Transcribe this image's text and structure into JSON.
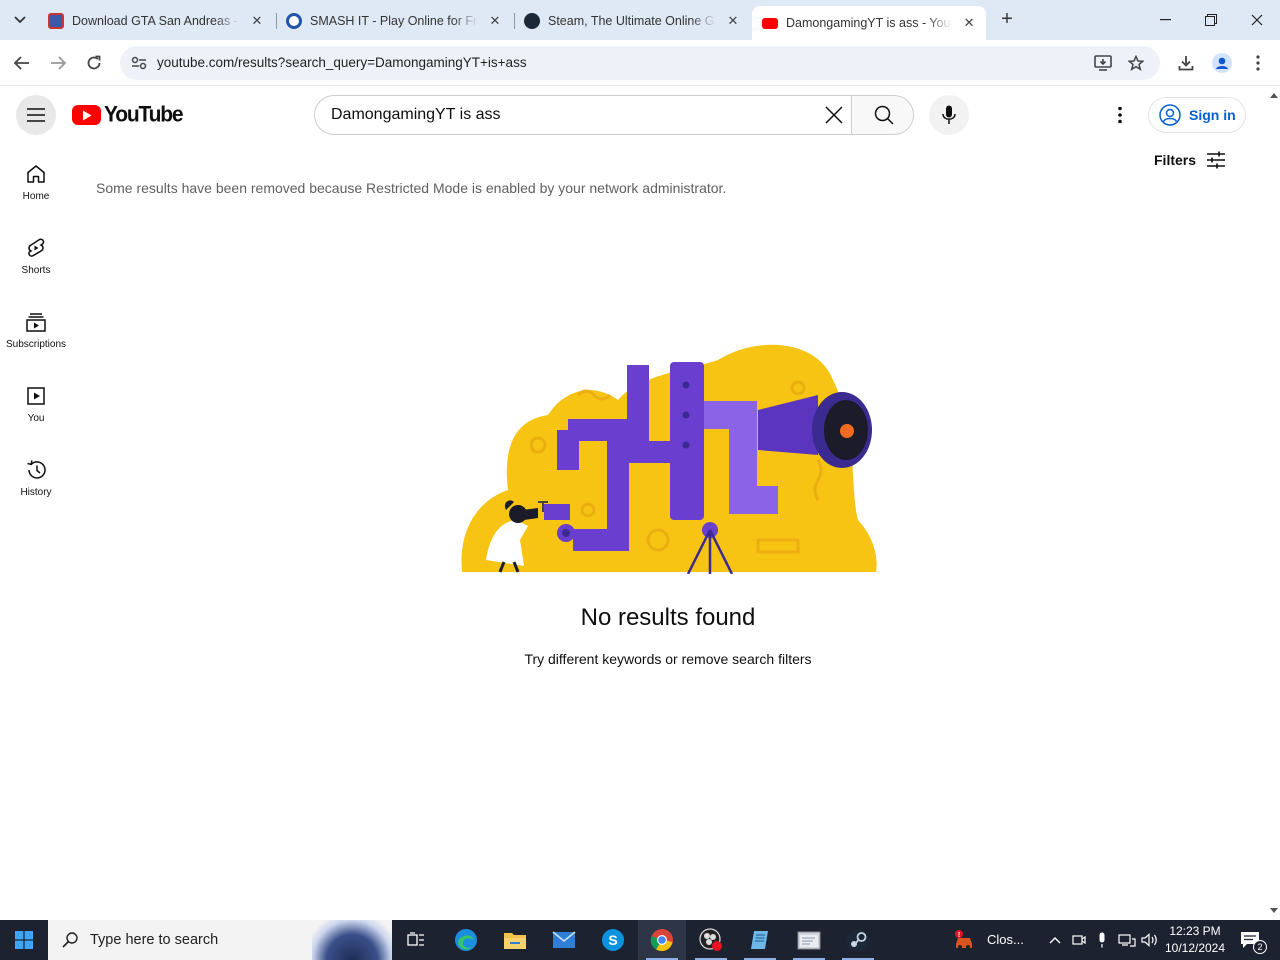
{
  "browser": {
    "tabs": [
      {
        "title": "Download GTA San Andreas - G",
        "active": false
      },
      {
        "title": "SMASH IT - Play Online for Free",
        "active": false
      },
      {
        "title": "Steam, The Ultimate Online Game",
        "active": false
      },
      {
        "title": "DamongamingYT is ass - YouTube",
        "active": true
      }
    ],
    "url": "youtube.com/results?search_query=DamongamingYT+is+ass"
  },
  "youtube": {
    "logo_text": "YouTube",
    "search_value": "DamongamingYT is ass",
    "sign_in_label": "Sign in",
    "filters_label": "Filters",
    "sidebar": [
      {
        "label": "Home"
      },
      {
        "label": "Shorts"
      },
      {
        "label": "Subscriptions"
      },
      {
        "label": "You"
      },
      {
        "label": "History"
      }
    ],
    "notice": "Some results have been removed because Restricted Mode is enabled by your network administrator.",
    "no_results_title": "No results found",
    "no_results_subtitle": "Try different keywords or remove search filters"
  },
  "taskbar": {
    "search_placeholder": "Type here to search",
    "tray_app_label": "Clos...",
    "time": "12:23 PM",
    "date": "10/12/2024",
    "notification_count": "2"
  },
  "colors": {
    "youtube_red": "#ff0000",
    "link_blue": "#065fd4",
    "illustration_yellow": "#f7c414",
    "illustration_purple": "#6a3fcf"
  }
}
